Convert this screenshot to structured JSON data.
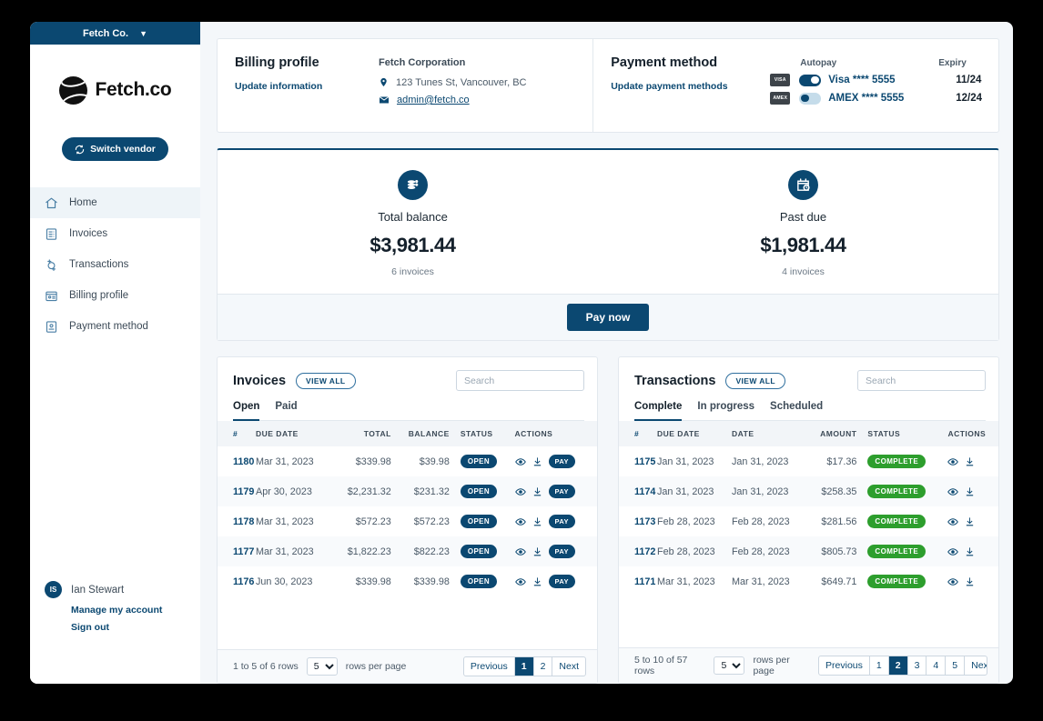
{
  "sidebar": {
    "vendor_bar": {
      "label": "Fetch Co.",
      "chevron": "chevron-down-icon"
    },
    "logo_text": "Fetch.co",
    "switch_vendor_label": "Switch vendor",
    "items": [
      {
        "label": "Home",
        "icon": "home-icon",
        "active": true
      },
      {
        "label": "Invoices",
        "icon": "invoice-icon",
        "active": false
      },
      {
        "label": "Transactions",
        "icon": "transactions-icon",
        "active": false
      },
      {
        "label": "Billing profile",
        "icon": "billing-profile-icon",
        "active": false
      },
      {
        "label": "Payment method",
        "icon": "payment-method-icon",
        "active": false
      }
    ],
    "user": {
      "initials": "IS",
      "name": "Ian Stewart",
      "manage_label": "Manage my account",
      "signout_label": "Sign out"
    }
  },
  "billing_profile": {
    "title": "Billing profile",
    "update_link": "Update information",
    "organization": "Fetch Corporation",
    "address": "123 Tunes St, Vancouver, BC",
    "email": "admin@fetch.co"
  },
  "payment_method": {
    "title": "Payment method",
    "update_link": "Update payment methods",
    "col_autopay": "Autopay",
    "col_expiry": "Expiry",
    "cards": [
      {
        "brand": "VISA",
        "autopay": true,
        "label": "Visa **** 5555",
        "expiry": "11/24"
      },
      {
        "brand": "AMEX",
        "autopay": false,
        "label": "AMEX **** 5555",
        "expiry": "12/24"
      }
    ]
  },
  "summary": {
    "total": {
      "icon": "coins-icon",
      "label": "Total balance",
      "amount": "$3,981.44",
      "sub": "6 invoices"
    },
    "past_due": {
      "icon": "calendar-clock-icon",
      "label": "Past due",
      "amount": "$1,981.44",
      "sub": "4 invoices"
    },
    "pay_now_label": "Pay now"
  },
  "invoices": {
    "title": "Invoices",
    "view_all_label": "VIEW ALL",
    "search_placeholder": "Search",
    "search_value": "",
    "tabs": [
      {
        "label": "Open",
        "active": true
      },
      {
        "label": "Paid",
        "active": false
      }
    ],
    "columns": [
      "#",
      "DUE DATE",
      "TOTAL",
      "BALANCE",
      "STATUS",
      "ACTIONS"
    ],
    "rows": [
      {
        "num": "1180",
        "due_date": "Mar 31, 2023",
        "total": "$339.98",
        "balance": "$39.98",
        "status": "OPEN",
        "pay_label": "PAY"
      },
      {
        "num": "1179",
        "due_date": "Apr 30, 2023",
        "total": "$2,231.32",
        "balance": "$231.32",
        "status": "OPEN",
        "pay_label": "PAY"
      },
      {
        "num": "1178",
        "due_date": "Mar 31, 2023",
        "total": "$572.23",
        "balance": "$572.23",
        "status": "OPEN",
        "pay_label": "PAY"
      },
      {
        "num": "1177",
        "due_date": "Mar 31, 2023",
        "total": "$1,822.23",
        "balance": "$822.23",
        "status": "OPEN",
        "pay_label": "PAY"
      },
      {
        "num": "1176",
        "due_date": "Jun 30, 2023",
        "total": "$339.98",
        "balance": "$339.98",
        "status": "OPEN",
        "pay_label": "PAY"
      }
    ],
    "footer": {
      "range": "1 to 5 of 6 rows",
      "rows_per_page_value": "5",
      "rows_per_page_label": "rows per page",
      "previous": "Previous",
      "pages": [
        "1",
        "2"
      ],
      "active_page": "1",
      "next": "Next"
    }
  },
  "transactions": {
    "title": "Transactions",
    "view_all_label": "VIEW ALL",
    "search_placeholder": "Search",
    "search_value": "",
    "tabs": [
      {
        "label": "Complete",
        "active": true
      },
      {
        "label": "In progress",
        "active": false
      },
      {
        "label": "Scheduled",
        "active": false
      }
    ],
    "columns": [
      "#",
      "DUE DATE",
      "DATE",
      "AMOUNT",
      "STATUS",
      "ACTIONS"
    ],
    "rows": [
      {
        "num": "1175",
        "due_date": "Jan 31, 2023",
        "date": "Jan 31, 2023",
        "amount": "$17.36",
        "status": "COMPLETE"
      },
      {
        "num": "1174",
        "due_date": "Jan 31, 2023",
        "date": "Jan 31, 2023",
        "amount": "$258.35",
        "status": "COMPLETE"
      },
      {
        "num": "1173",
        "due_date": "Feb 28, 2023",
        "date": "Feb 28, 2023",
        "amount": "$281.56",
        "status": "COMPLETE"
      },
      {
        "num": "1172",
        "due_date": "Feb 28, 2023",
        "date": "Feb 28, 2023",
        "amount": "$805.73",
        "status": "COMPLETE"
      },
      {
        "num": "1171",
        "due_date": "Mar 31, 2023",
        "date": "Mar 31, 2023",
        "amount": "$649.71",
        "status": "COMPLETE"
      }
    ],
    "footer": {
      "range": "5 to 10 of 57 rows",
      "rows_per_page_value": "5",
      "rows_per_page_label": "rows per page",
      "previous": "Previous",
      "pages": [
        "1",
        "2",
        "3",
        "4",
        "5"
      ],
      "active_page": "2",
      "next": "Next"
    }
  },
  "colors": {
    "brand": "#0b4871",
    "page_bg": "#f4f7fa",
    "status_open": "#0b4871",
    "status_complete": "#2d9e2d",
    "card_chip": "#3d4349"
  }
}
